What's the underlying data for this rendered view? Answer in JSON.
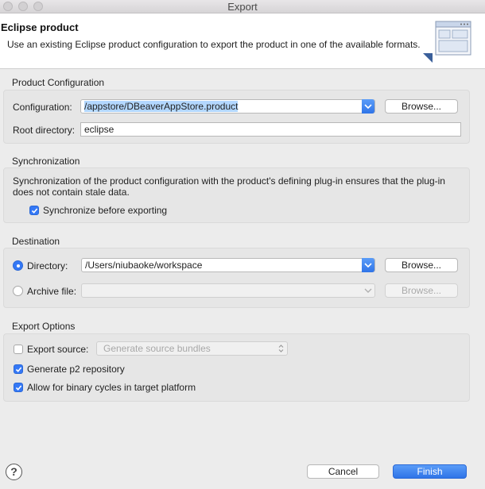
{
  "window": {
    "title": "Export"
  },
  "header": {
    "title": "Eclipse product",
    "description": "Use an existing Eclipse product configuration to export the product in one of the available formats."
  },
  "product_configuration": {
    "group_label": "Product Configuration",
    "configuration_label": "Configuration:",
    "configuration_value": "/appstore/DBeaverAppStore.product",
    "browse_label": "Browse...",
    "root_directory_label": "Root directory:",
    "root_directory_value": "eclipse"
  },
  "synchronization": {
    "group_label": "Synchronization",
    "description_line1": "Synchronization of the product configuration with the product's defining plug-in ensures that the plug-in",
    "description_line2": "does not contain stale data.",
    "checkbox_label": "Synchronize before exporting",
    "checked": true
  },
  "destination": {
    "group_label": "Destination",
    "directory_label": "Directory:",
    "directory_value": "/Users/niubaoke/workspace",
    "directory_selected": true,
    "directory_browse_label": "Browse...",
    "archive_label": "Archive file:",
    "archive_value": "",
    "archive_browse_label": "Browse..."
  },
  "export_options": {
    "group_label": "Export Options",
    "export_source_label": "Export source:",
    "export_source_checked": false,
    "export_source_option": "Generate source bundles",
    "generate_p2_label": "Generate p2 repository",
    "generate_p2_checked": true,
    "binary_cycles_label": "Allow for binary cycles in target platform",
    "binary_cycles_checked": true
  },
  "footer": {
    "help_glyph": "?",
    "cancel_label": "Cancel",
    "finish_label": "Finish"
  },
  "colors": {
    "accent": "#3478f6",
    "background": "#ececec"
  }
}
